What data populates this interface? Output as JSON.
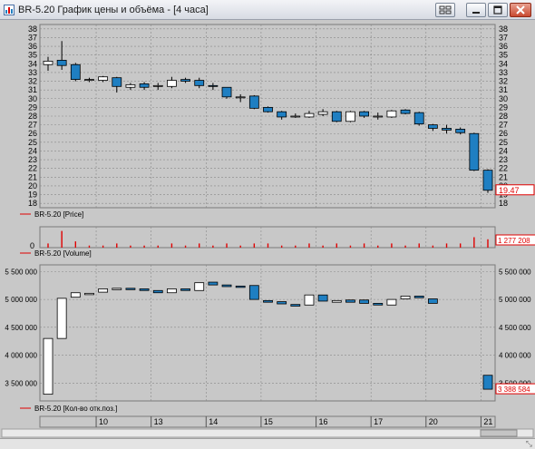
{
  "window": {
    "title": "BR-5.20 График цены и объёма - [4 часа]",
    "resize_glyph": "⤡"
  },
  "price_panel": {
    "legend": "BR-5.20 [Price]",
    "y_ticks": [
      38,
      37,
      36,
      35,
      34,
      33,
      32,
      31,
      30,
      29,
      28,
      27,
      26,
      25,
      24,
      23,
      22,
      21,
      20,
      19,
      18
    ],
    "last_value": "19.47",
    "ylim": [
      17.5,
      38.5
    ]
  },
  "volume_panel": {
    "legend": "BR-5.20 [Volume]",
    "zero_label": "0",
    "last_value": "1 277 208"
  },
  "oi_panel": {
    "legend": "BR-5.20 [Кол-во отк.поз.]",
    "y_ticks": [
      "5 500 000",
      "5 000 000",
      "4 500 000",
      "4 000 000",
      "3 500 000"
    ],
    "y_tick_values": [
      5500000,
      5000000,
      4500000,
      4000000,
      3500000
    ],
    "ylim": [
      3180000,
      5620000
    ],
    "last_value": "3 388 584"
  },
  "x_axis": {
    "labels": [
      {
        "text": "10",
        "after_candle": 3
      },
      {
        "text": "13",
        "after_candle": 7
      },
      {
        "text": "14",
        "after_candle": 11
      },
      {
        "text": "15",
        "after_candle": 15
      },
      {
        "text": "16",
        "after_candle": 19
      },
      {
        "text": "17",
        "after_candle": 23
      },
      {
        "text": "20",
        "after_candle": 27
      },
      {
        "text": "21",
        "after_candle": 31
      }
    ]
  },
  "chart_data": {
    "type": "candlestick",
    "candles": [
      {
        "o": 33.9,
        "h": 34.8,
        "l": 33.2,
        "c": 34.3
      },
      {
        "o": 34.4,
        "h": 36.6,
        "l": 33.3,
        "c": 33.8
      },
      {
        "o": 33.9,
        "h": 34.1,
        "l": 32.0,
        "c": 32.2
      },
      {
        "o": 32.1,
        "h": 32.4,
        "l": 31.9,
        "c": 32.2
      },
      {
        "o": 32.1,
        "h": 32.6,
        "l": 31.9,
        "c": 32.5
      },
      {
        "o": 32.4,
        "h": 32.5,
        "l": 30.7,
        "c": 31.4
      },
      {
        "o": 31.3,
        "h": 31.8,
        "l": 31.0,
        "c": 31.6
      },
      {
        "o": 31.7,
        "h": 31.9,
        "l": 31.0,
        "c": 31.3
      },
      {
        "o": 31.4,
        "h": 31.8,
        "l": 31.0,
        "c": 31.5
      },
      {
        "o": 31.4,
        "h": 32.5,
        "l": 31.2,
        "c": 32.1
      },
      {
        "o": 32.2,
        "h": 32.4,
        "l": 31.8,
        "c": 32.0
      },
      {
        "o": 32.1,
        "h": 32.4,
        "l": 31.2,
        "c": 31.5
      },
      {
        "o": 31.5,
        "h": 31.8,
        "l": 31.0,
        "c": 31.4
      },
      {
        "o": 31.3,
        "h": 31.3,
        "l": 30.0,
        "c": 30.2
      },
      {
        "o": 30.1,
        "h": 30.5,
        "l": 29.6,
        "c": 30.2
      },
      {
        "o": 30.3,
        "h": 30.4,
        "l": 28.8,
        "c": 28.9
      },
      {
        "o": 29.0,
        "h": 29.1,
        "l": 28.4,
        "c": 28.5
      },
      {
        "o": 28.5,
        "h": 28.6,
        "l": 27.6,
        "c": 27.9
      },
      {
        "o": 27.9,
        "h": 28.3,
        "l": 27.8,
        "c": 28.0
      },
      {
        "o": 27.9,
        "h": 28.6,
        "l": 27.8,
        "c": 28.3
      },
      {
        "o": 28.2,
        "h": 28.8,
        "l": 28.0,
        "c": 28.5
      },
      {
        "o": 28.5,
        "h": 28.6,
        "l": 27.3,
        "c": 27.4
      },
      {
        "o": 27.4,
        "h": 28.6,
        "l": 27.3,
        "c": 28.5
      },
      {
        "o": 28.5,
        "h": 28.6,
        "l": 27.8,
        "c": 28.0
      },
      {
        "o": 28.0,
        "h": 28.4,
        "l": 27.6,
        "c": 28.0
      },
      {
        "o": 27.9,
        "h": 28.7,
        "l": 27.8,
        "c": 28.6
      },
      {
        "o": 28.7,
        "h": 28.8,
        "l": 28.2,
        "c": 28.3
      },
      {
        "o": 28.4,
        "h": 28.5,
        "l": 26.9,
        "c": 27.1
      },
      {
        "o": 27.0,
        "h": 27.1,
        "l": 26.3,
        "c": 26.6
      },
      {
        "o": 26.6,
        "h": 27.0,
        "l": 26.0,
        "c": 26.4
      },
      {
        "o": 26.5,
        "h": 26.7,
        "l": 25.9,
        "c": 26.1
      },
      {
        "o": 26.0,
        "h": 26.1,
        "l": 21.7,
        "c": 21.8
      },
      {
        "o": 21.8,
        "h": 21.9,
        "l": 19.2,
        "c": 19.5
      }
    ],
    "volume": [
      2,
      8,
      3,
      1,
      1,
      2,
      1,
      1,
      1,
      2,
      1,
      2,
      1,
      2,
      1,
      2,
      2,
      1,
      1,
      2,
      1,
      2,
      1,
      2,
      1,
      2,
      1,
      2,
      1,
      2,
      2,
      5,
      4
    ],
    "volume_relative_max": 10,
    "open_interest": [
      {
        "o": 3300000,
        "c": 4300000
      },
      {
        "o": 4300000,
        "c": 5020000
      },
      {
        "o": 5040000,
        "c": 5120000
      },
      {
        "o": 5100000,
        "c": 5110000
      },
      {
        "o": 5130000,
        "c": 5190000
      },
      {
        "o": 5180000,
        "c": 5200000
      },
      {
        "o": 5200000,
        "c": 5190000
      },
      {
        "o": 5190000,
        "c": 5160000
      },
      {
        "o": 5160000,
        "c": 5120000
      },
      {
        "o": 5120000,
        "c": 5190000
      },
      {
        "o": 5190000,
        "c": 5160000
      },
      {
        "o": 5160000,
        "c": 5300000
      },
      {
        "o": 5310000,
        "c": 5260000
      },
      {
        "o": 5260000,
        "c": 5230000
      },
      {
        "o": 5240000,
        "c": 5230000
      },
      {
        "o": 5250000,
        "c": 5000000
      },
      {
        "o": 4980000,
        "c": 4950000
      },
      {
        "o": 4960000,
        "c": 4920000
      },
      {
        "o": 4910000,
        "c": 4880000
      },
      {
        "o": 4900000,
        "c": 5080000
      },
      {
        "o": 5080000,
        "c": 4970000
      },
      {
        "o": 4950000,
        "c": 4980000
      },
      {
        "o": 4990000,
        "c": 4950000
      },
      {
        "o": 4990000,
        "c": 4930000
      },
      {
        "o": 4930000,
        "c": 4900000
      },
      {
        "o": 4900000,
        "c": 5000000
      },
      {
        "o": 5010000,
        "c": 5060000
      },
      {
        "o": 5060000,
        "c": 5030000
      },
      {
        "o": 5010000,
        "c": 4930000
      },
      {
        "o": 3640000,
        "c": 3390000
      }
    ]
  },
  "colors": {
    "bear": "#1f7fc2",
    "bull": "#ffffff",
    "outline": "#000000",
    "volume": "#e00000",
    "last_value_box": "#e00000",
    "grid": "#888888",
    "panel_bg": "#c8c8c8"
  }
}
